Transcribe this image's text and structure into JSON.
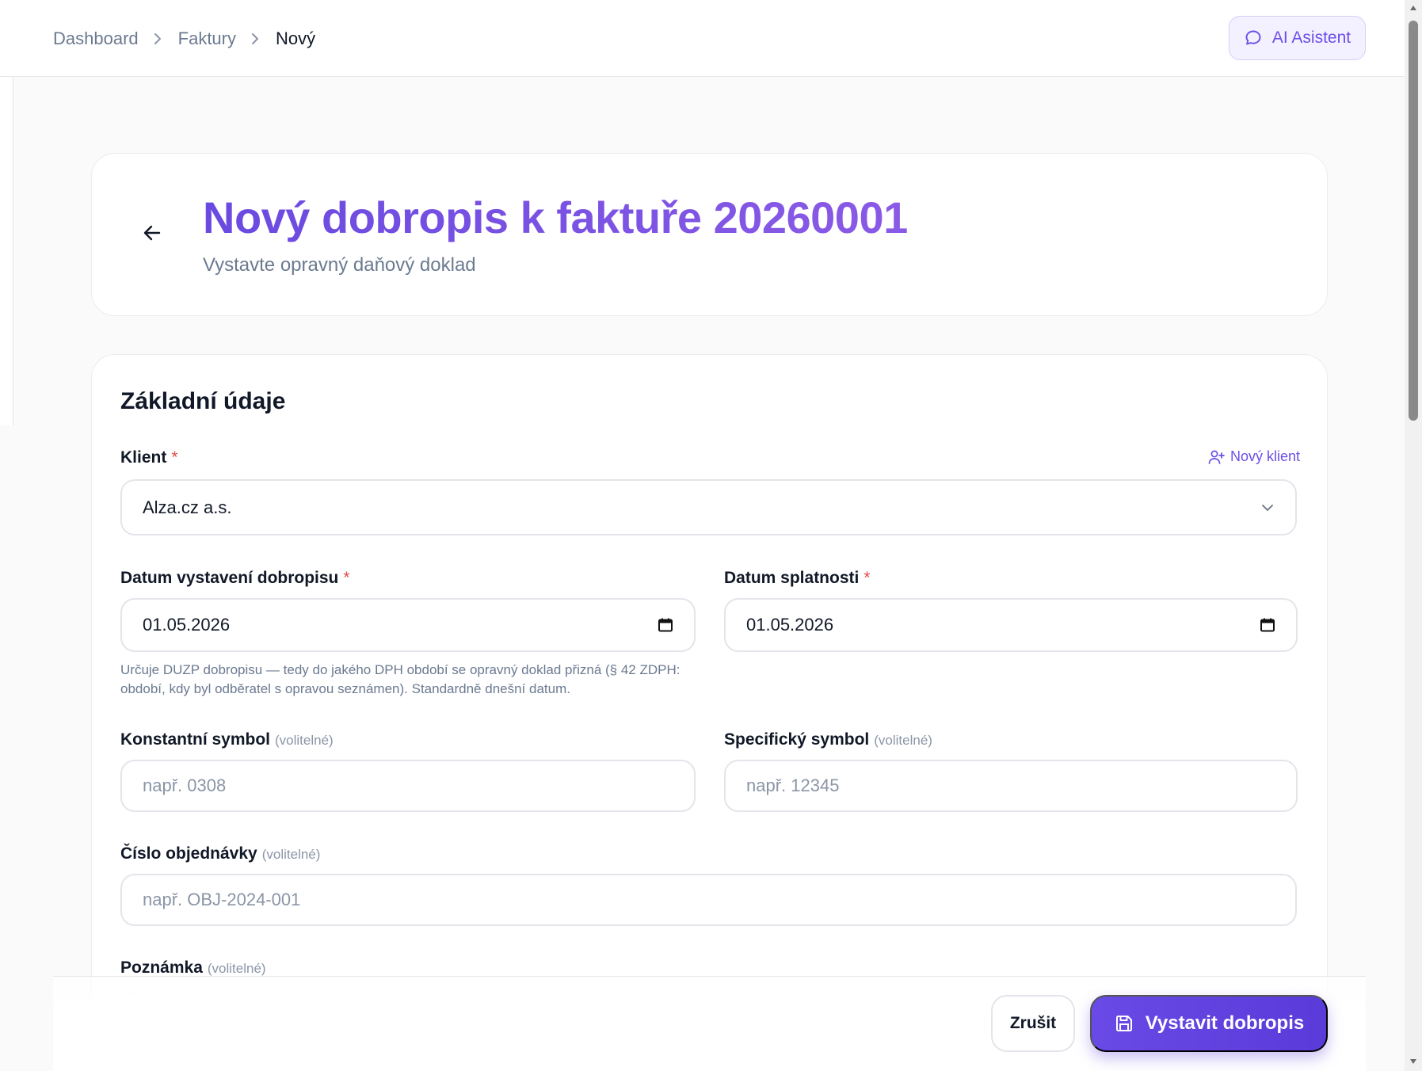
{
  "breadcrumb": {
    "items": [
      "Dashboard",
      "Faktury",
      "Nový"
    ]
  },
  "header": {
    "ai_button_label": "AI Asistent"
  },
  "page": {
    "title": "Nový dobropis k faktuře 20260001",
    "subtitle": "Vystavte opravný daňový doklad"
  },
  "form": {
    "section_title": "Základní údaje",
    "client": {
      "label": "Klient",
      "required_mark": "*",
      "value": "Alza.cz a.s.",
      "new_client_label": "Nový klient"
    },
    "issue_date": {
      "label": "Datum vystavení dobropisu",
      "required_mark": "*",
      "value": "01.05.2026",
      "hint": "Určuje DUZP dobropisu — tedy do jakého DPH období se opravný doklad přizná (§ 42 ZDPH: období, kdy byl odběratel s opravou seznámen). Standardně dnešní datum."
    },
    "due_date": {
      "label": "Datum splatnosti",
      "required_mark": "*",
      "value": "01.05.2026"
    },
    "constant_symbol": {
      "label": "Konstantní symbol",
      "optional": "(volitelné)",
      "placeholder": "např. 0308"
    },
    "specific_symbol": {
      "label": "Specifický symbol",
      "optional": "(volitelné)",
      "placeholder": "např. 12345"
    },
    "order_number": {
      "label": "Číslo objednávky",
      "optional": "(volitelné)",
      "placeholder": "např. OBJ-2024-001"
    },
    "note": {
      "label": "Poznámka",
      "optional": "(volitelné)"
    }
  },
  "actions": {
    "cancel_label": "Zrušit",
    "submit_label": "Vystavit dobropis"
  },
  "colors": {
    "accent": "#6d4fe6",
    "required": "#e24b4b",
    "muted_text": "#6b7a90"
  }
}
